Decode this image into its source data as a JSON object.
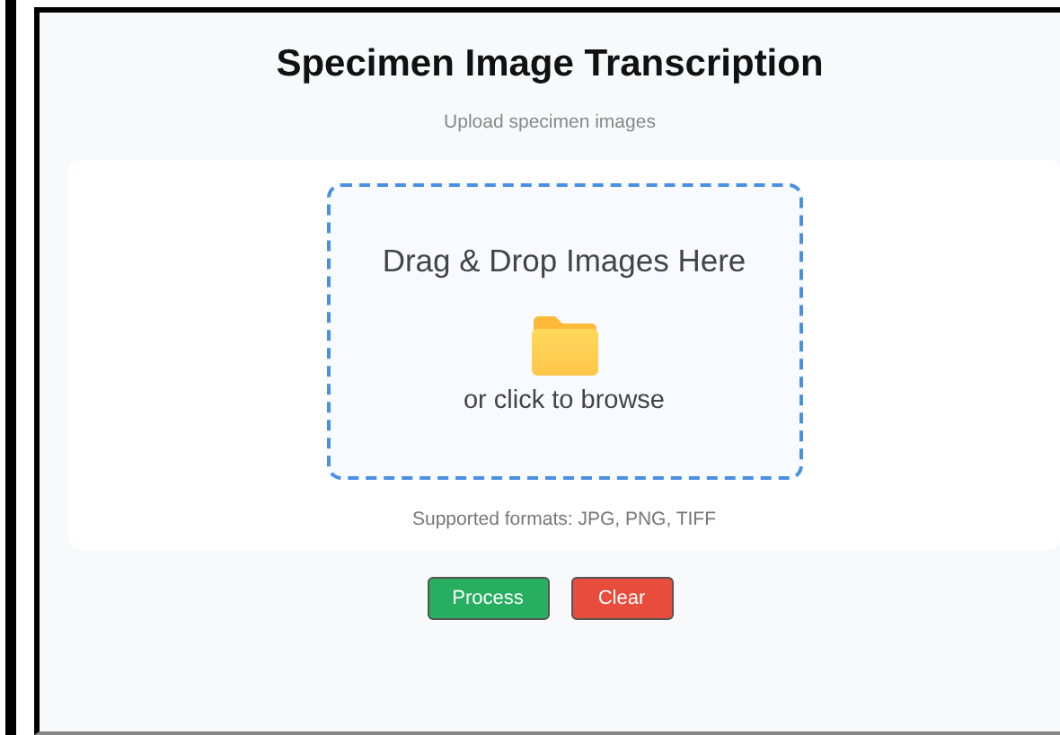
{
  "title": "Specimen Image Transcription",
  "subtitle": "Upload specimen images",
  "dropzone": {
    "heading": "Drag & Drop Images Here",
    "hint": "or click to browse"
  },
  "formats_note": "Supported formats: JPG, PNG, TIFF",
  "buttons": [
    {
      "label": "Process",
      "kind": "primary"
    },
    {
      "label": "Clear",
      "kind": "danger"
    }
  ]
}
